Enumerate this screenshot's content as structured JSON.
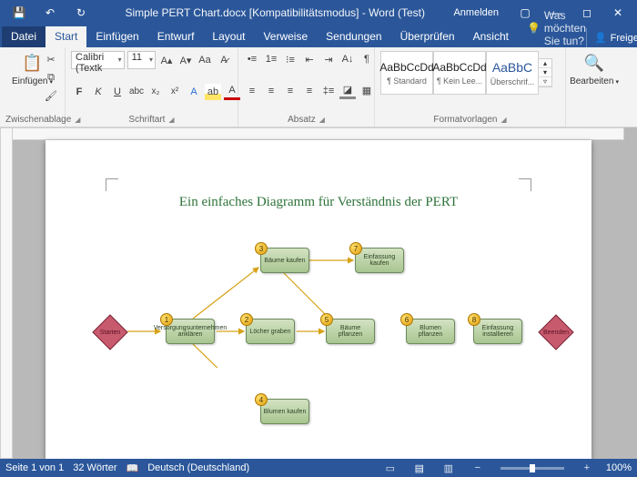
{
  "titlebar": {
    "doc_title": "Simple PERT Chart.docx [Kompatibilitätsmodus] - Word (Test)",
    "signin": "Anmelden"
  },
  "tabs": {
    "datei": "Datei",
    "start": "Start",
    "einfuegen": "Einfügen",
    "entwurf": "Entwurf",
    "layout": "Layout",
    "verweise": "Verweise",
    "sendungen": "Sendungen",
    "ueberpruefen": "Überprüfen",
    "ansicht": "Ansicht",
    "tellme": "Was möchten Sie tun?",
    "freigeben": "Freigeben"
  },
  "ribbon": {
    "paste": "Einfügen",
    "clipboard_group": "Zwischenablage",
    "font_name": "Calibri (Textk",
    "font_size": "11",
    "font_group": "Schriftart",
    "para_group": "Absatz",
    "styles_group": "Formatvorlagen",
    "edit": "Bearbeiten",
    "style1_prev": "AaBbCcDd",
    "style1_name": "¶ Standard",
    "style2_prev": "AaBbCcDd",
    "style2_name": "¶ Kein Lee...",
    "style3_prev": "AaBbC",
    "style3_name": "Überschrif..."
  },
  "doc": {
    "title": "Ein einfaches Diagramm für Verständnis der PERT"
  },
  "chart_data": {
    "type": "pert-diagram",
    "start": "Starten",
    "end": "Beenden",
    "tasks": [
      {
        "id": 1,
        "label": "Versorgungsunternehmen anklären"
      },
      {
        "id": 2,
        "label": "Löcher graben"
      },
      {
        "id": 3,
        "label": "Bäume kaufen"
      },
      {
        "id": 4,
        "label": "Blumen kaufen"
      },
      {
        "id": 5,
        "label": "Bäume pflanzen"
      },
      {
        "id": 6,
        "label": "Blumen pflanzen"
      },
      {
        "id": 7,
        "label": "Einfassung kaufen"
      },
      {
        "id": 8,
        "label": "Einfassung installieren"
      }
    ],
    "edges": [
      [
        "start",
        1
      ],
      [
        1,
        2
      ],
      [
        1,
        3
      ],
      [
        1,
        4
      ],
      [
        2,
        5
      ],
      [
        3,
        5
      ],
      [
        3,
        7
      ],
      [
        4,
        6
      ],
      [
        5,
        6
      ],
      [
        7,
        8
      ],
      [
        6,
        8
      ],
      [
        8,
        "end"
      ]
    ]
  },
  "status": {
    "page": "Seite 1 von 1",
    "words": "32 Wörter",
    "lang": "Deutsch (Deutschland)",
    "zoom": "100%"
  }
}
